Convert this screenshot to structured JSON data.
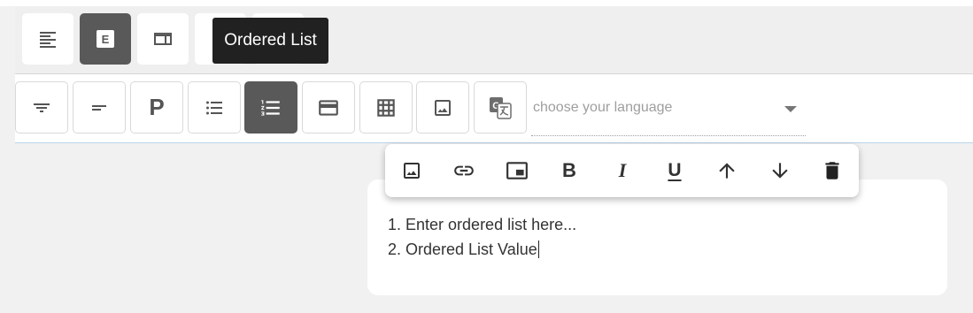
{
  "mode_bar": {
    "buttons": [
      {
        "name": "align-left-mode-button",
        "icon": "align-left-icon",
        "active": false
      },
      {
        "name": "editor-mode-button",
        "icon": "editor-e-icon",
        "active": true,
        "icon_text": "E"
      },
      {
        "name": "layout-mode-button",
        "icon": "web-layout-icon",
        "active": false
      },
      {
        "name": "mode-button-4",
        "icon": "unknown-icon",
        "active": false
      },
      {
        "name": "mode-button-5",
        "icon": "unknown-icon",
        "active": false
      }
    ],
    "tooltip": "Ordered List"
  },
  "toolbar": {
    "buttons": [
      {
        "name": "filter-button",
        "icon": "filter-list-icon",
        "active": false
      },
      {
        "name": "short-text-button",
        "icon": "short-text-icon",
        "active": false
      },
      {
        "name": "paragraph-button",
        "icon": "paragraph-p-icon",
        "active": false,
        "icon_text": "P"
      },
      {
        "name": "bullet-list-button",
        "icon": "bullet-list-icon",
        "active": false
      },
      {
        "name": "ordered-list-button",
        "icon": "ordered-list-icon",
        "active": true
      },
      {
        "name": "card-button",
        "icon": "credit-card-icon",
        "active": false
      },
      {
        "name": "table-button",
        "icon": "grid-table-icon",
        "active": false
      },
      {
        "name": "image-button",
        "icon": "image-icon",
        "active": false
      },
      {
        "name": "translate-button",
        "icon": "translate-icon",
        "active": false
      }
    ],
    "language_placeholder": "choose your language"
  },
  "floating_toolbar": {
    "buttons": [
      {
        "name": "insert-image-button",
        "icon": "image-icon"
      },
      {
        "name": "insert-link-button",
        "icon": "link-icon"
      },
      {
        "name": "picture-in-picture-button",
        "icon": "picture-in-picture-icon"
      },
      {
        "name": "bold-button",
        "icon": "bold-icon",
        "icon_text": "B"
      },
      {
        "name": "italic-button",
        "icon": "italic-icon",
        "icon_text": "I"
      },
      {
        "name": "underline-button",
        "icon": "underline-icon",
        "icon_text": "U"
      },
      {
        "name": "move-up-button",
        "icon": "arrow-up-icon"
      },
      {
        "name": "move-down-button",
        "icon": "arrow-down-icon"
      },
      {
        "name": "delete-button",
        "icon": "trash-icon"
      }
    ]
  },
  "editor": {
    "items": [
      "1. Enter ordered list here...",
      "2. Ordered List Value"
    ]
  },
  "colors": {
    "active_bg": "#595959",
    "tooltip_bg": "#212121",
    "page_bg": "#f1f1f1"
  }
}
